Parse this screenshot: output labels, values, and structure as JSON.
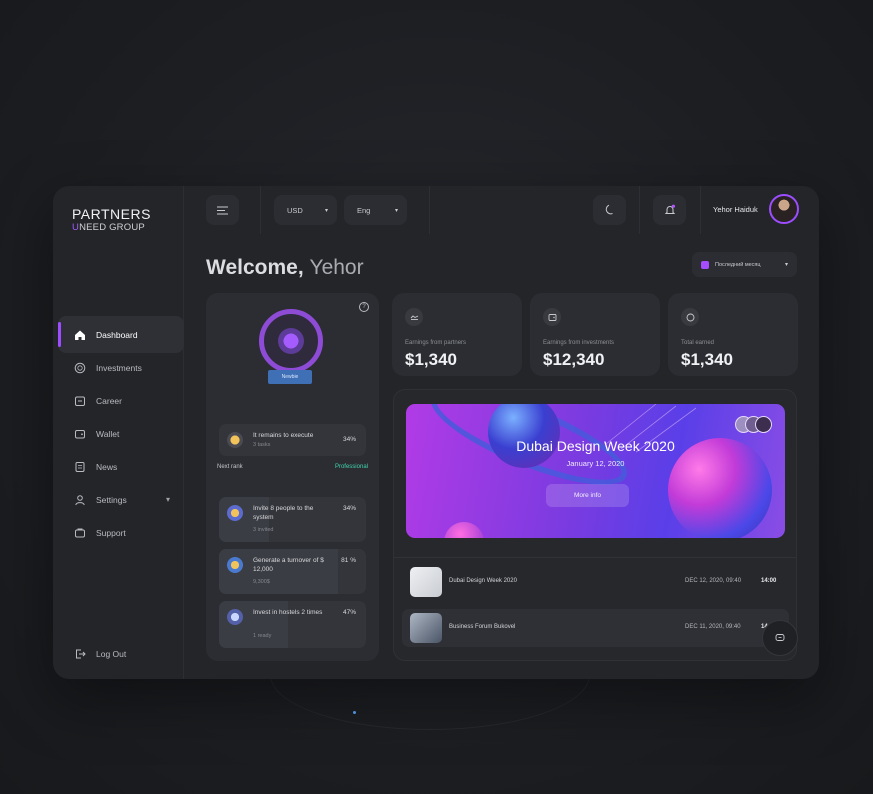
{
  "brand": {
    "top": "PARTNERS",
    "u": "U",
    "bottom": "NEED GROUP"
  },
  "sidebar": {
    "items": [
      {
        "label": "Dashboard",
        "icon": "home-icon",
        "active": true
      },
      {
        "label": "Investments",
        "icon": "coin-icon"
      },
      {
        "label": "Career",
        "icon": "career-icon"
      },
      {
        "label": "Wallet",
        "icon": "wallet-icon"
      },
      {
        "label": "News",
        "icon": "news-icon"
      },
      {
        "label": "Settings",
        "icon": "user-settings-icon",
        "chevron": "▾"
      },
      {
        "label": "Support",
        "icon": "support-icon"
      }
    ],
    "logout": "Log Out"
  },
  "topbar": {
    "currency": "USD",
    "language": "Eng",
    "user_name": "Yehor Haiduk"
  },
  "welcome": {
    "greeting": "Welcome, ",
    "name": "Yehor"
  },
  "period_select": "Последний месяц",
  "rank_card": {
    "badge_label": "Newbie",
    "help": "?",
    "remains": {
      "title": "It remains to execute",
      "sub": "3 tasks",
      "pct": "34%"
    },
    "next_rank_label": "Next rank",
    "next_rank_value": "Professional",
    "tasks": [
      {
        "title": "Invite 8 people to the system",
        "sub": "3 invited",
        "pct": "34%",
        "progress": 0.34
      },
      {
        "title": "Generate a turnover of $ 12,000",
        "sub": "9,300$",
        "pct": "81 %",
        "progress": 0.81
      },
      {
        "title": "Invest in hostels 2 times",
        "sub": "1 ready",
        "pct": "47%",
        "progress": 0.47
      }
    ]
  },
  "stats": [
    {
      "label": "Earnings from partners",
      "value": "$1,340",
      "icon": "handshake-icon"
    },
    {
      "label": "Earnings from investments",
      "value": "$12,340",
      "icon": "wallet-icon"
    },
    {
      "label": "Total earned",
      "value": "$1,340",
      "icon": "coin-icon"
    }
  ],
  "hero": {
    "title": "Dubai Design Week 2020",
    "date": "January 12, 2020",
    "button": "More info"
  },
  "events": [
    {
      "name": "Dubai Design Week 2020",
      "date": "DEC 12, 2020, 09:40",
      "time": "14:00"
    },
    {
      "name": "Business Forum Bukovel",
      "date": "DEC 11, 2020, 09:40",
      "time": "14:"
    }
  ],
  "colors": {
    "accent": "#9b4dff",
    "teal": "#43d3b0",
    "panel": "#2b2d32"
  }
}
